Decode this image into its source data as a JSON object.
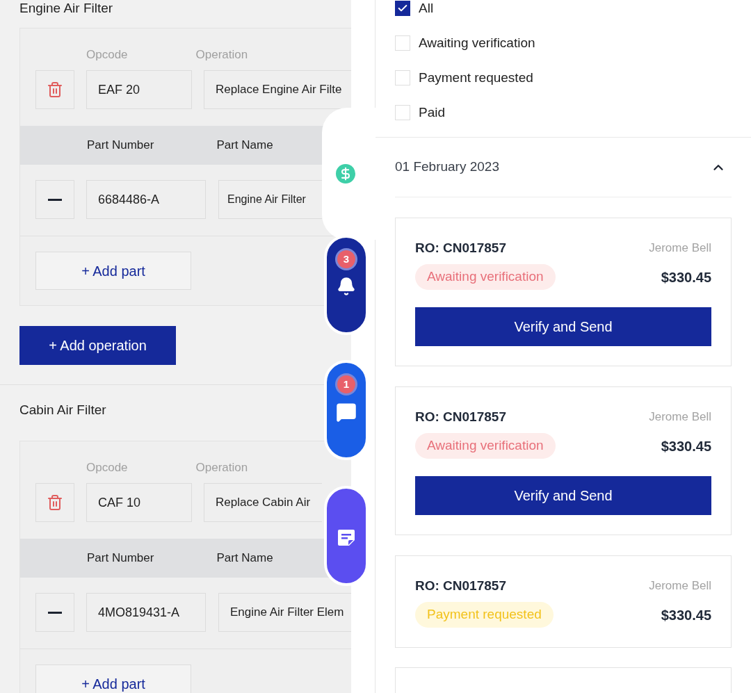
{
  "sections": [
    {
      "title": "Engine Air Filter",
      "opcode_label": "Opcode",
      "operation_label": "Operation",
      "opcode": "EAF 20",
      "operation": "Replace Engine Air Filte",
      "part_columns": [
        "Part Number",
        "Part Name"
      ],
      "parts": [
        {
          "number": "6684486-A",
          "name": "Engine Air Filter"
        }
      ],
      "add_part": "+ Add part",
      "add_operation": "+ Add operation"
    },
    {
      "title": "Cabin Air Filter",
      "opcode_label": "Opcode",
      "operation_label": "Operation",
      "opcode": "CAF 10",
      "operation": "Replace Cabin Air",
      "part_columns": [
        "Part Number",
        "Part Name"
      ],
      "parts": [
        {
          "number": "4MO819431-A",
          "name": "Engine Air Filter Elem"
        }
      ],
      "add_part": "+ Add part"
    }
  ],
  "side_tabs": [
    {
      "kind": "payment",
      "selected": true,
      "color": "#3ecfa8"
    },
    {
      "kind": "notifications",
      "selected": false,
      "color": "#15299a",
      "badge": "3"
    },
    {
      "kind": "messages",
      "selected": false,
      "color": "#1a5ee6",
      "badge": "1"
    },
    {
      "kind": "notes",
      "selected": false,
      "color": "#5b4ef0"
    }
  ],
  "filters": [
    {
      "label": "All",
      "checked": true
    },
    {
      "label": "Awaiting verification",
      "checked": false
    },
    {
      "label": "Payment requested",
      "checked": false
    },
    {
      "label": "Paid",
      "checked": false
    }
  ],
  "date_group": {
    "date": "01 February 2023",
    "expanded": true
  },
  "orders": [
    {
      "ro": "RO: CN017857",
      "customer": "Jerome Bell",
      "status": "Awaiting verification",
      "kind": "awaiting",
      "amount": "$330.45",
      "action": "Verify and Send"
    },
    {
      "ro": "RO: CN017857",
      "customer": "Jerome Bell",
      "status": "Awaiting verification",
      "kind": "awaiting",
      "amount": "$330.45",
      "action": "Verify and Send"
    },
    {
      "ro": "RO: CN017857",
      "customer": "Jerome Bell",
      "status": "Payment requested",
      "kind": "requested",
      "amount": "$330.45"
    }
  ]
}
